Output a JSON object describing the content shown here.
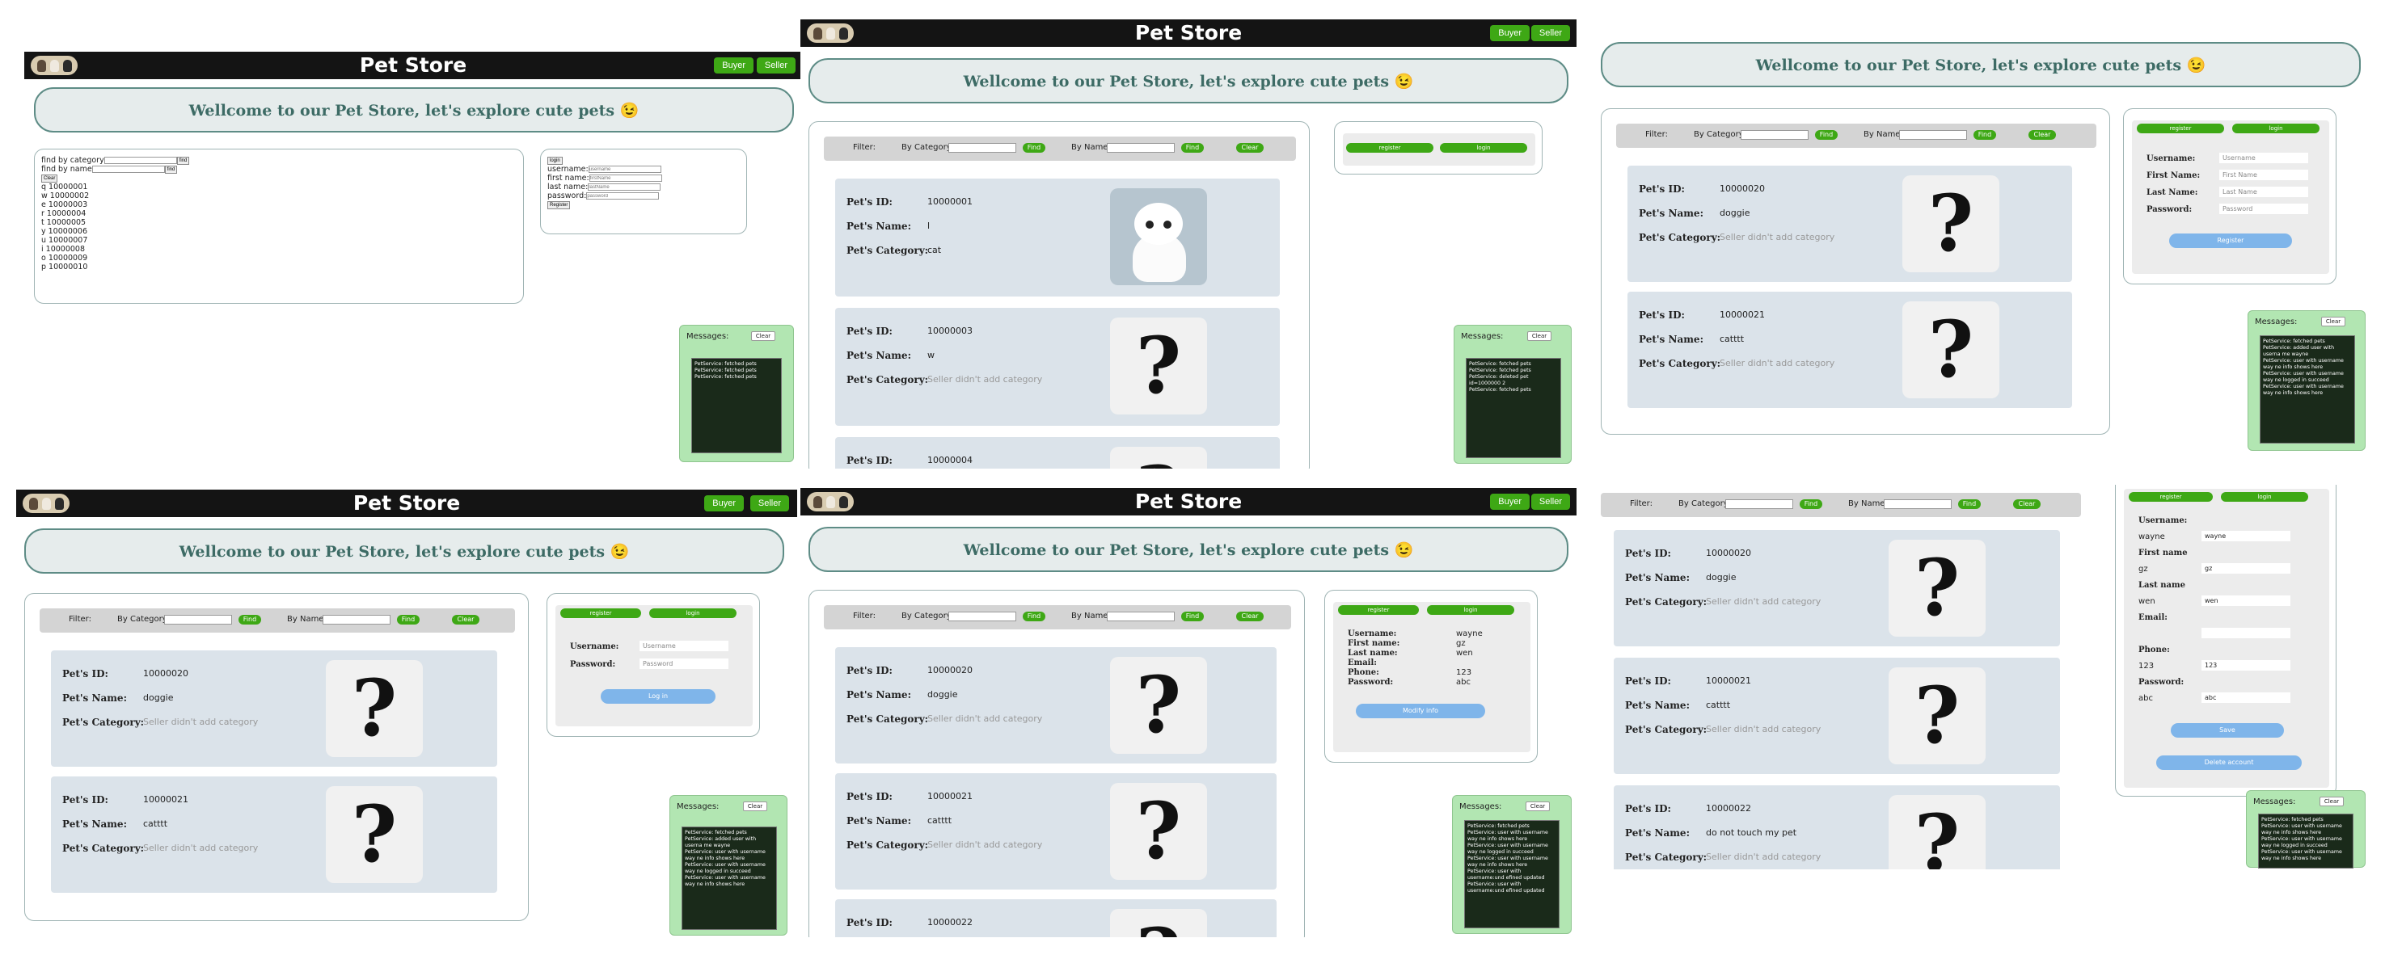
{
  "app": {
    "title": "Pet Store",
    "buyer_label": "Buyer",
    "seller_label": "Seller",
    "welcome": "Wellcome to our Pet Store, let's explore cute pets 😉"
  },
  "filter": {
    "label": "Filter:",
    "by_category": "By Category",
    "by_name": "By Name",
    "find": "Find",
    "clear": "Clear"
  },
  "tabs": {
    "register": "register",
    "login": "login"
  },
  "labels": {
    "id": "Pet's ID:",
    "name": "Pet's Name:",
    "category": "Pet's Category:",
    "no_category": "Seller didn't add category"
  },
  "pets": [
    {
      "id": "10000001",
      "name": "l",
      "category": "cat"
    },
    {
      "id": "10000003",
      "name": "w"
    },
    {
      "id": "10000004"
    },
    {
      "id": "10000020",
      "name": "doggie"
    },
    {
      "id": "10000021",
      "name": "catttt"
    },
    {
      "id": "10000022",
      "name": "do not touch my pet"
    }
  ],
  "raw_panel": {
    "find_by_category": "find by category",
    "find_by_name": "find by name",
    "find": "find",
    "clear": "Clear",
    "login": "login",
    "username": "username:",
    "first_name": "first name:",
    "last_name": "last name:",
    "password": "password:",
    "username_ph": "username",
    "firstname_ph": "firstName",
    "lastname_ph": "lastName",
    "password_ph": "password",
    "register": "Register",
    "list": [
      "q 10000001",
      "w 10000002",
      "e 10000003",
      "r 10000004",
      "t 10000005",
      "y 10000006",
      "u 10000007",
      "i 10000008",
      "o 10000009",
      "p 10000010"
    ]
  },
  "forms": {
    "username": "Username:",
    "first_name": "First Name:",
    "last_name": "Last Name:",
    "password": "Password:",
    "username_ph": "Username",
    "first_ph": "First Name",
    "last_ph": "Last Name",
    "password_ph": "Password",
    "register_btn": "Register",
    "login_btn": "Log in"
  },
  "profile": {
    "username_label": "Username:",
    "first_label": "First name:",
    "last_label": "Last name:",
    "email_label": "Email:",
    "phone_label": "Phone:",
    "password_label": "Password:",
    "username": "wayne",
    "first": "gz",
    "last": "wen",
    "phone": "123",
    "password": "abc",
    "modify": "Modify info",
    "first_name_label": "First name",
    "last_name_label": "Last name",
    "save": "Save",
    "delete": "Delete account"
  },
  "messages": {
    "title": "Messages:",
    "clear": "Clear",
    "log1": [
      "PetService: fetched pets",
      "PetService: fetched pets",
      "PetService: fetched pets"
    ],
    "log2": [
      "PetService: fetched pets",
      "PetService: fetched pets",
      "PetService: deleted pet id=1000000 2",
      "PetService: fetched pets"
    ],
    "log3": [
      "PetService: fetched pets",
      "PetService: added user with userna me wayne",
      "PetService: user with username way ne info shows here",
      "PetService: user with username way ne logged in succeed",
      "PetService: user with username way ne info shows here"
    ],
    "log4": [
      "PetService: fetched pets",
      "PetService: added user with userna me wayne",
      "PetService: user with username way ne info shows here",
      "PetService: user with username way ne logged in succeed",
      "PetService: user with username way ne info shows here"
    ],
    "log5": [
      "PetService: fetched pets",
      "PetService: user with username way ne info shows here",
      "PetService: user with username way ne logged in succeed",
      "PetService: user with username way ne info shows here",
      "PetService: user with username:und efined updated",
      "PetService: user with username:und efined updated"
    ],
    "log6": [
      "PetService: fetched pets",
      "PetService: user with username way ne info shows here",
      "PetService: user with username way ne logged in succeed",
      "PetService: user with username way ne info shows here"
    ]
  }
}
